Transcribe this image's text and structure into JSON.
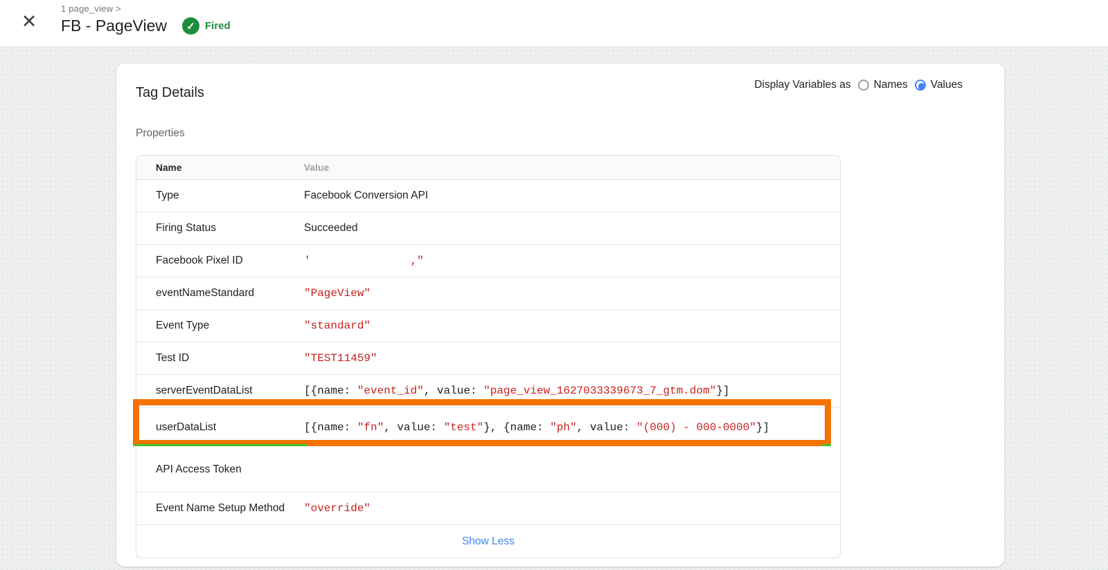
{
  "icons": {
    "close": "✕",
    "check": "✓"
  },
  "colors": {
    "accent_blue": "#4285f4",
    "fired_green": "#1e8e3e",
    "code_red": "#c5221f",
    "highlight_orange": "#f57300",
    "underline_green": "#3fc22f"
  },
  "header": {
    "breadcrumb": "1 page_view >",
    "title": "FB - PageView",
    "status": "Fired"
  },
  "card": {
    "title": "Tag Details",
    "display_variables": {
      "label": "Display Variables as",
      "options": [
        {
          "label": "Names",
          "selected": false
        },
        {
          "label": "Values",
          "selected": true
        }
      ]
    },
    "section_title": "Properties",
    "table": {
      "columns": [
        "Name",
        "Value"
      ],
      "rows": [
        {
          "name": "Type",
          "value": [
            {
              "k": "text",
              "t": "Facebook Conversion API"
            }
          ]
        },
        {
          "name": "Firing Status",
          "value": [
            {
              "k": "text",
              "t": "Succeeded"
            }
          ]
        },
        {
          "name": "Facebook Pixel ID",
          "value": [
            {
              "k": "str",
              "t": "'"
            },
            {
              "k": "gap",
              "t": "               "
            },
            {
              "k": "str",
              "t": ",\""
            }
          ]
        },
        {
          "name": "eventNameStandard",
          "value": [
            {
              "k": "str",
              "t": "\"PageView\""
            }
          ]
        },
        {
          "name": "Event Type",
          "value": [
            {
              "k": "str",
              "t": "\"standard\""
            }
          ]
        },
        {
          "name": "Test ID",
          "value": [
            {
              "k": "str",
              "t": "\"TEST11459\""
            }
          ]
        },
        {
          "name": "serverEventDataList",
          "value": [
            {
              "k": "punct",
              "t": "[{name: "
            },
            {
              "k": "str",
              "t": "\"event_id\""
            },
            {
              "k": "punct",
              "t": ", value: "
            },
            {
              "k": "str",
              "t": "\"page_view_1627033339673_7_gtm.dom\""
            },
            {
              "k": "punct",
              "t": "}]"
            }
          ]
        },
        {
          "name": "userDataList",
          "highlight": true,
          "value": [
            {
              "k": "punct",
              "t": "[{name: "
            },
            {
              "k": "str",
              "t": "\"fn\""
            },
            {
              "k": "punct",
              "t": ", value: "
            },
            {
              "k": "str",
              "t": "\"test\""
            },
            {
              "k": "punct",
              "t": "}, {name: "
            },
            {
              "k": "str",
              "t": "\"ph\""
            },
            {
              "k": "punct",
              "t": ", value: "
            },
            {
              "k": "str",
              "t": "\"(000) - 000-0000\""
            },
            {
              "k": "punct",
              "t": "}]"
            }
          ]
        },
        {
          "name": "API Access Token",
          "tall": true,
          "value": []
        },
        {
          "name": "Event Name Setup Method",
          "value": [
            {
              "k": "str",
              "t": "\"override\""
            }
          ]
        }
      ],
      "footer_link": "Show Less"
    }
  }
}
